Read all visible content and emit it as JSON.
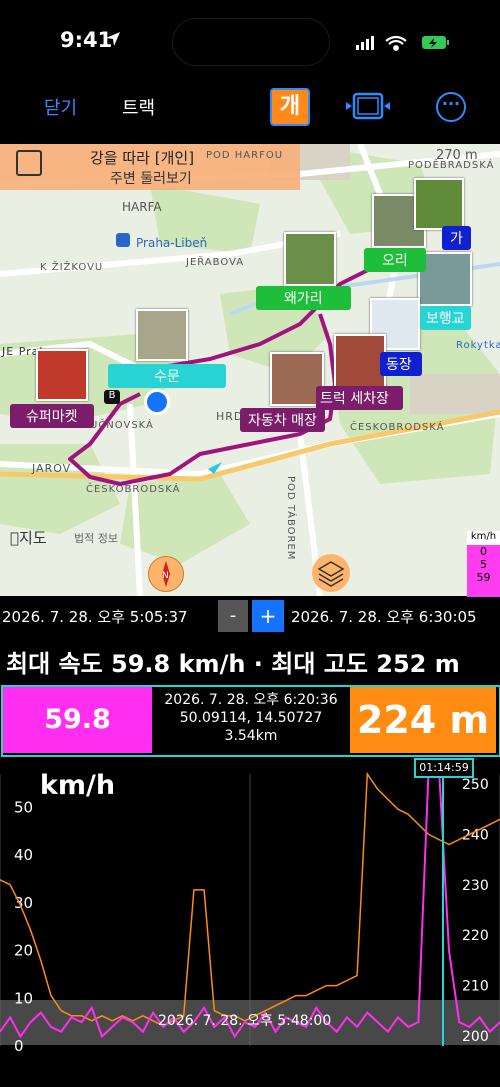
{
  "status_bar": {
    "time": "9:41"
  },
  "nav": {
    "close_label": "닫기",
    "title": "트랙",
    "private_label": "개",
    "video_icon": "video-icon",
    "more_icon": "ellipsis-icon"
  },
  "map": {
    "card_title": "강을 따라 [개인]",
    "card_subtitle": "주변 둘러보기",
    "scale": "270 m",
    "streets": [
      "HARFA",
      "Praha-Libeň",
      "K ŽIŽKOVU",
      "JEŘABOVA",
      "JE Praha",
      "UČNOVSKÁ",
      "JAROV",
      "ČESKOBRODSKÁ",
      "POD TÁBOREM",
      "HRD",
      "PODĚBRADSKÁ",
      "Rokytka",
      "ČESKOBRODSKÁ",
      "POD HARFOU"
    ],
    "pois": [
      {
        "label": "수문",
        "color": "cyan"
      },
      {
        "label": "슈퍼마켓",
        "color": "purple"
      },
      {
        "label": "왜가리",
        "color": "green"
      },
      {
        "label": "오리",
        "color": "green"
      },
      {
        "label": "가",
        "color": "blue"
      },
      {
        "label": "보행교",
        "color": "cyan"
      },
      {
        "label": "동장",
        "color": "blue"
      },
      {
        "label": "트럭 세차장",
        "color": "purple"
      },
      {
        "label": "자동차 매장",
        "color": "purple"
      }
    ],
    "maps_logo": "지도",
    "legal": "법적 정보",
    "legend": {
      "unit": "km/h",
      "ticks": [
        "0",
        "5",
        "59"
      ]
    },
    "markers": [
      "B"
    ]
  },
  "range": {
    "start": "2026. 7. 28. 오후 5:05:37",
    "end": "2026. 7. 28. 오후 6:30:05",
    "minus": "-",
    "plus": "+"
  },
  "stats_line": "최대 속도 59.8 km/h · 최대 고도 252 m",
  "info": {
    "speed": "59.8 km/h",
    "timestamp": "2026. 7. 28. 오후 6:20:36",
    "coords": "50.09114, 14.50727",
    "distance": "3.54km",
    "altitude": "224 m"
  },
  "chart": {
    "marker_time": "01:14:59",
    "cursor_time": "2026. 7. 28. 오후 5:48:00",
    "left_ticks": [
      "0",
      "10",
      "20",
      "30",
      "40",
      "50"
    ],
    "right_ticks": [
      "200",
      "210",
      "220",
      "230",
      "240",
      "250"
    ],
    "colors": {
      "speed": "#ff2ef0",
      "altitude": "#ff8c12",
      "cursor": "#27d3d3"
    }
  },
  "chart_data": {
    "type": "line",
    "x_range": [
      "오후 5:05:37",
      "오후 6:30:05"
    ],
    "series": [
      {
        "axis": "left",
        "unit": "km/h",
        "ylim": [
          0,
          57
        ],
        "values": [
          3,
          6,
          2,
          5,
          7,
          4,
          3,
          6,
          5,
          8,
          2,
          4,
          6,
          5,
          3,
          7,
          4,
          6,
          3,
          5,
          8,
          4,
          6,
          2,
          5,
          4,
          7,
          3,
          6,
          5,
          4,
          8,
          5,
          3,
          6,
          4,
          7,
          5,
          3,
          6,
          4,
          5,
          58,
          59,
          20,
          5,
          4,
          6,
          3,
          5
        ]
      },
      {
        "axis": "right",
        "unit": "m",
        "ylim": [
          198,
          252
        ],
        "values": [
          231,
          230,
          226,
          221,
          215,
          208,
          205,
          204,
          204,
          203,
          204,
          203,
          204,
          203,
          204,
          203,
          202,
          203,
          204,
          229,
          229,
          205,
          204,
          204,
          203,
          204,
          205,
          206,
          207,
          208,
          208,
          209,
          210,
          210,
          211,
          212,
          252,
          249,
          247,
          245,
          244,
          242,
          240,
          239,
          238,
          239,
          240,
          241,
          242,
          243
        ]
      }
    ]
  }
}
